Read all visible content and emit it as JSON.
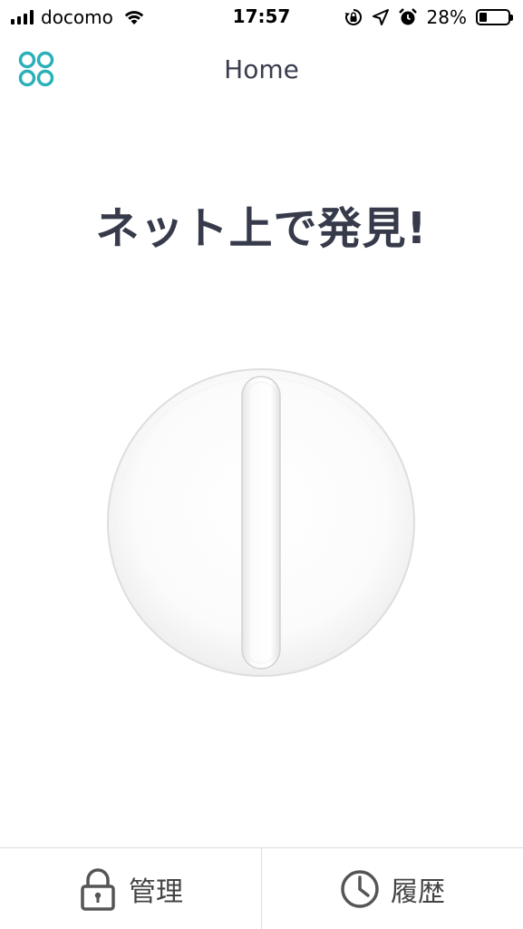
{
  "status_bar": {
    "carrier": "docomo",
    "time": "17:57",
    "battery_percent": "28%",
    "battery_level": 0.28,
    "icons": [
      "signal-icon",
      "wifi-icon",
      "rotation-lock-icon",
      "location-icon",
      "alarm-icon",
      "battery-icon"
    ]
  },
  "header": {
    "title": "Home",
    "menu_icon": "four-circles-icon"
  },
  "main": {
    "headline": "ネット上で発見!",
    "device_image": "lock-device-illustration"
  },
  "tabbar": {
    "tabs": [
      {
        "label": "管理",
        "icon": "lock-icon"
      },
      {
        "label": "履歴",
        "icon": "clock-icon"
      }
    ]
  },
  "colors": {
    "accent": "#2ab0b8",
    "text": "#373a4a"
  }
}
